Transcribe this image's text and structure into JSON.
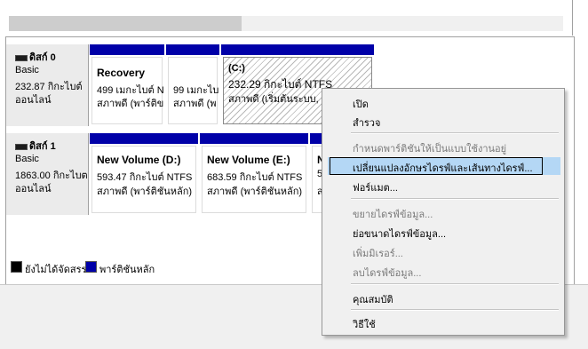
{
  "disks": [
    {
      "name": "ดิสก์ 0",
      "type": "Basic",
      "size": "232.87 กิกะไบต์",
      "status": "ออนไลน์",
      "partitions": [
        {
          "title": "Recovery",
          "size": "499 เมกะไบต์ N",
          "status": "สภาพดี (พาร์ติข"
        },
        {
          "title": "",
          "size": "99 เมกะไบ",
          "status": "สภาพดี (พ"
        },
        {
          "title": "(C:)",
          "size": "232.29 กิกะไบต์ NTFS",
          "status": "สภาพดี (เริ่มต้นระบบ, แฟ"
        }
      ]
    },
    {
      "name": "ดิสก์ 1",
      "type": "Basic",
      "size": "1863.00 กิกะไบต",
      "status": "ออนไลน์",
      "partitions": [
        {
          "title": "New Volume  (D:)",
          "size": "593.47 กิกะไบต์ NTFS",
          "status": "สภาพดี (พาร์ติชันหลัก)"
        },
        {
          "title": "New Volume  (E:)",
          "size": "683.59 กิกะไบต์ NTFS",
          "status": "สภาพดี (พาร์ติชันหลัก)"
        },
        {
          "title": "N",
          "size": "5",
          "status": "ส"
        }
      ]
    }
  ],
  "legend": {
    "unallocated": "ยังไม่ได้จัดสรร",
    "primary": "พาร์ติชันหลัก",
    "unallocated_color": "#000000",
    "primary_color": "#0000a8"
  },
  "context_menu": {
    "items": [
      {
        "label": "เปิด",
        "disabled": false
      },
      {
        "label": "สำรวจ",
        "disabled": false
      },
      {
        "label": "กำหนดพาร์ติชันให้เป็นแบบใช้งานอยู่",
        "disabled": true
      },
      {
        "label": "เปลี่ยนแปลงอักษรไดรฟ์และเส้นทางไดรฟ์...",
        "disabled": false,
        "highlighted": true
      },
      {
        "label": "ฟอร์แมต...",
        "disabled": false
      },
      {
        "label": "ขยายไดรฟ์ข้อมูล...",
        "disabled": true
      },
      {
        "label": "ย่อขนาดไดรฟ์ข้อมูล...",
        "disabled": false
      },
      {
        "label": "เพิ่มมิเรอร์...",
        "disabled": true
      },
      {
        "label": "ลบไดรฟ์ข้อมูล...",
        "disabled": true
      },
      {
        "label": "คุณสมบัติ",
        "disabled": false
      },
      {
        "label": "วิธีใช้",
        "disabled": false
      }
    ],
    "highlight_color": "#b4d7f5"
  }
}
